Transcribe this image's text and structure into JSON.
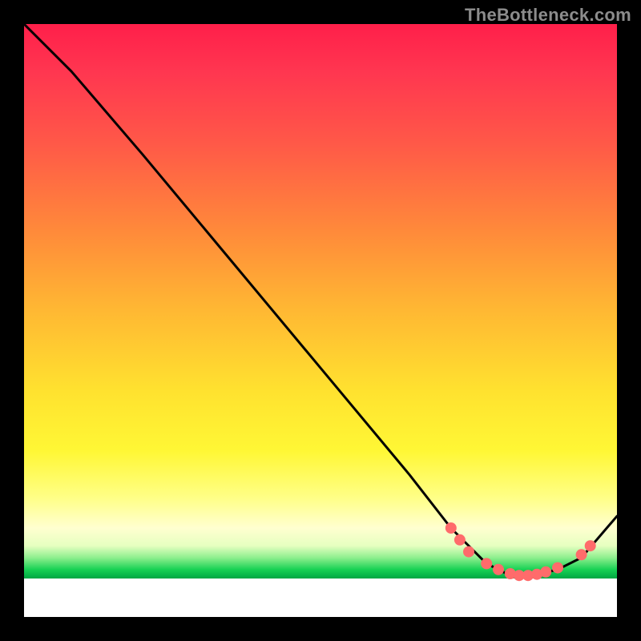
{
  "watermark": "TheBottleneck.com",
  "chart_data": {
    "type": "line",
    "title": "",
    "xlabel": "",
    "ylabel": "",
    "xlim": [
      0,
      100
    ],
    "ylim": [
      0,
      100
    ],
    "grid": false,
    "series": [
      {
        "name": "bottleneck-curve",
        "x": [
          0,
          8,
          20,
          35,
          50,
          65,
          72,
          78,
          82,
          86,
          90,
          94,
          100
        ],
        "y": [
          100,
          92,
          78,
          60,
          42,
          24,
          15,
          9,
          7,
          7,
          8,
          10,
          17
        ],
        "color": "#000000"
      }
    ],
    "markers": [
      {
        "name": "cluster-left",
        "x": 72,
        "y": 15,
        "color": "#ff6b6b"
      },
      {
        "name": "cluster-left2",
        "x": 73.5,
        "y": 13,
        "color": "#ff6b6b"
      },
      {
        "name": "cluster-left3",
        "x": 75,
        "y": 11,
        "color": "#ff6b6b"
      },
      {
        "name": "point-a",
        "x": 78,
        "y": 9,
        "color": "#ff6b6b"
      },
      {
        "name": "point-b",
        "x": 80,
        "y": 8,
        "color": "#ff6b6b"
      },
      {
        "name": "point-c",
        "x": 82,
        "y": 7.3,
        "color": "#ff6b6b"
      },
      {
        "name": "point-d",
        "x": 83.5,
        "y": 7,
        "color": "#ff6b6b"
      },
      {
        "name": "point-e",
        "x": 85,
        "y": 7,
        "color": "#ff6b6b"
      },
      {
        "name": "point-f",
        "x": 86.5,
        "y": 7.2,
        "color": "#ff6b6b"
      },
      {
        "name": "point-g",
        "x": 88,
        "y": 7.6,
        "color": "#ff6b6b"
      },
      {
        "name": "point-h",
        "x": 90,
        "y": 8.3,
        "color": "#ff6b6b"
      },
      {
        "name": "cluster-right",
        "x": 94,
        "y": 10.5,
        "color": "#ff6b6b"
      },
      {
        "name": "cluster-right2",
        "x": 95.5,
        "y": 12,
        "color": "#ff6b6b"
      }
    ],
    "background_bands": [
      {
        "name": "red-zone",
        "from_y": 60,
        "to_y": 100,
        "color": "#ff2a4a"
      },
      {
        "name": "orange-zone",
        "from_y": 35,
        "to_y": 60,
        "color": "#ff9a38"
      },
      {
        "name": "yellow-zone",
        "from_y": 12,
        "to_y": 35,
        "color": "#ffee3a"
      },
      {
        "name": "green-zone",
        "from_y": 6.5,
        "to_y": 12,
        "color": "#1ac756"
      },
      {
        "name": "white-base",
        "from_y": 0,
        "to_y": 6.5,
        "color": "#ffffff"
      }
    ]
  }
}
